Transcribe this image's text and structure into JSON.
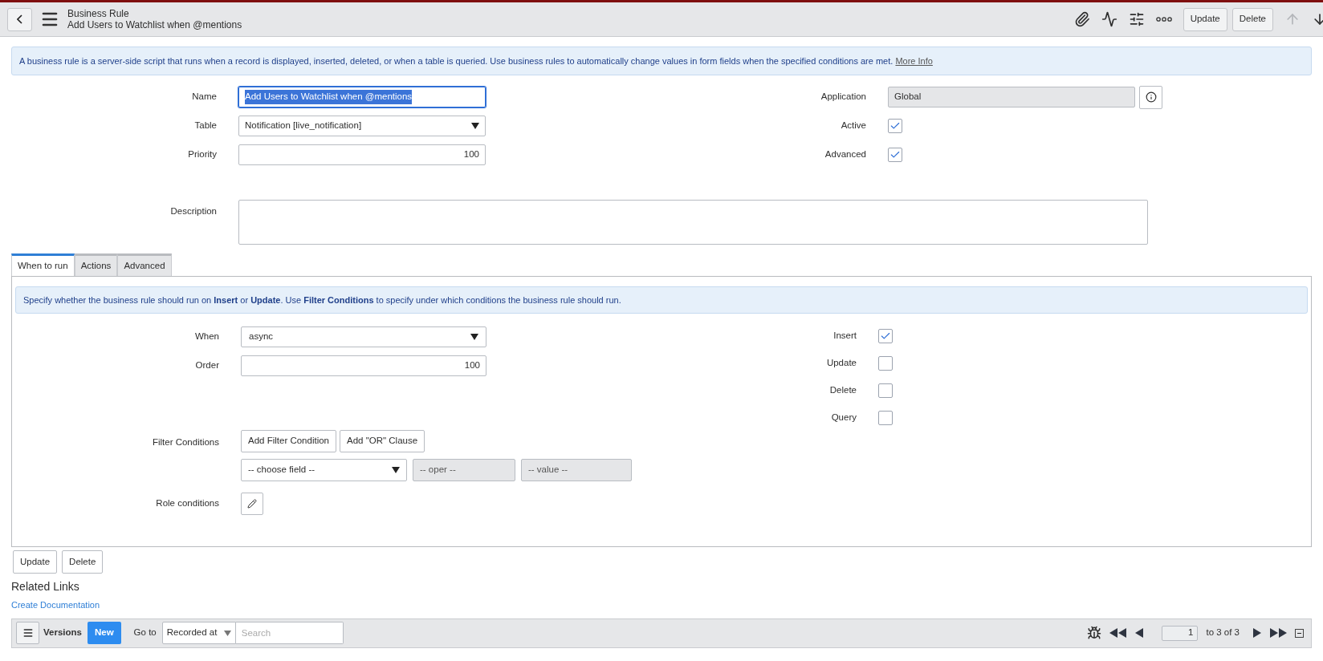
{
  "header": {
    "title": "Business Rule",
    "subtitle": "Add Users to Watchlist when @mentions",
    "buttons": [
      "Update",
      "Delete"
    ]
  },
  "info": {
    "text": "A business rule is a server-side script that runs when a record is displayed, inserted, deleted, or when a table is queried. Use business rules to automatically change values in form fields when the specified conditions are met.",
    "link": "More Info"
  },
  "fields_left": [
    {
      "label": "Name",
      "kind": "text",
      "value": "Add Users to Watchlist when @mentions",
      "focused": true
    },
    {
      "label": "Table",
      "kind": "select",
      "value": "Notification [live_notification]",
      "focused": false
    },
    {
      "label": "Priority",
      "kind": "number",
      "value": "100",
      "focused": false
    }
  ],
  "fields_right": [
    {
      "label": "Application",
      "kind": "readonly",
      "value": "Global"
    },
    {
      "label": "Active",
      "kind": "checkbox",
      "checked": true
    },
    {
      "label": "Advanced",
      "kind": "checkbox",
      "checked": true
    }
  ],
  "description": {
    "label": "Description"
  },
  "tabs": [
    {
      "label": "When to run",
      "selected": true
    },
    {
      "label": "Actions",
      "selected": false
    },
    {
      "label": "Advanced",
      "selected": false
    }
  ],
  "tab_info": "Specify whether the business rule should run on **Insert** or **Update**. Use **Filter Conditions** to specify under which conditions the business rule should run.",
  "when_fields": [
    {
      "label": "When",
      "kind": "select",
      "value": "async"
    },
    {
      "label": "Order",
      "kind": "number",
      "value": "100"
    }
  ],
  "operations": [
    {
      "label": "Insert",
      "checked": true
    },
    {
      "label": "Update",
      "checked": false
    },
    {
      "label": "Delete",
      "checked": false
    },
    {
      "label": "Query",
      "checked": false
    }
  ],
  "filter": {
    "label": "Filter Conditions",
    "buttons": [
      "Add Filter Condition",
      "Add \"OR\" Clause"
    ],
    "field": "-- choose field --",
    "oper": "-- oper --",
    "value": "-- value --"
  },
  "role_conditions": {
    "label": "Role conditions"
  },
  "bottom_buttons": [
    "Update",
    "Delete"
  ],
  "related_links": {
    "title": "Related Links",
    "links": [
      "Create Documentation"
    ]
  },
  "versions": {
    "title": "Versions",
    "new_button": "New",
    "goto_label": "Go to",
    "goto_select": "Recorded at",
    "search_placeholder": "Search",
    "page": "1",
    "page_info": "to 3 of 3"
  }
}
